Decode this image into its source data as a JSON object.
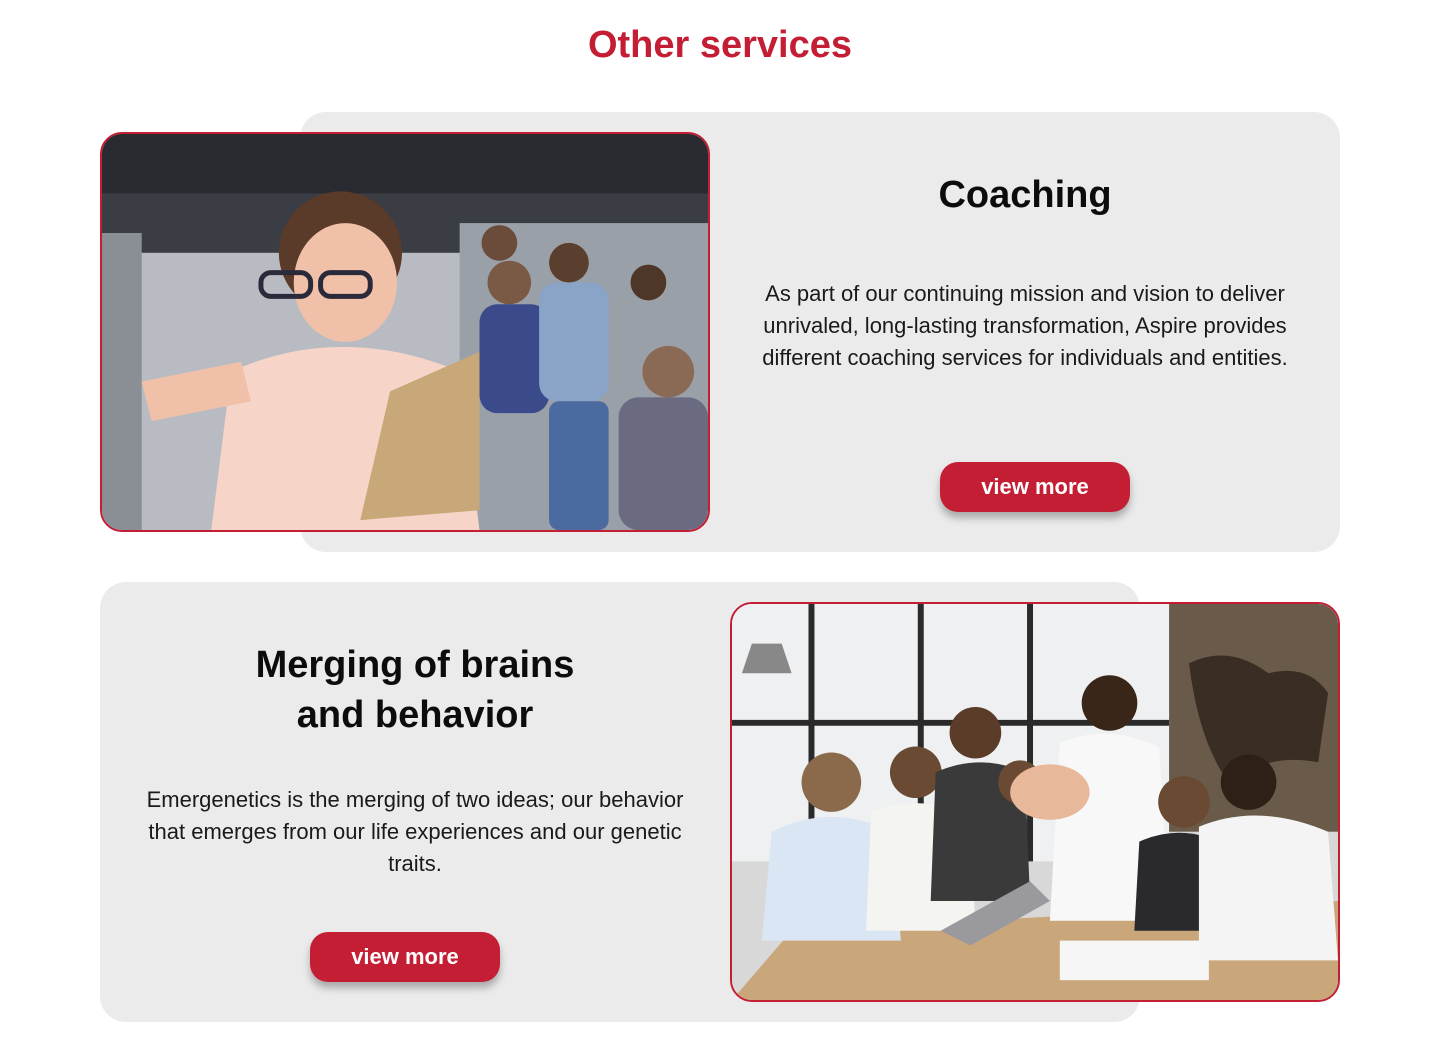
{
  "colors": {
    "accent": "#c41e35",
    "card_bg": "#ebebeb"
  },
  "section": {
    "title": "Other services"
  },
  "services": [
    {
      "title": "Coaching",
      "description": "As part of our continuing mission and vision to deliver unrivaled, long-lasting transformation, Aspire provides different coaching services for individuals and entities.",
      "button_label": "view more",
      "image_icon": "coaching-photo"
    },
    {
      "title": "Merging of brains and behavior",
      "description": "Emergenetics is the merging of two ideas; our behavior that emerges from our life experiences and our genetic traits.",
      "button_label": "view more",
      "image_icon": "team-high-five-photo"
    }
  ]
}
